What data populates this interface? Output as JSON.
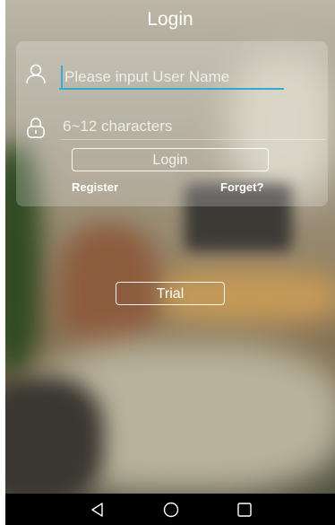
{
  "header": {
    "title": "Login"
  },
  "form": {
    "username_placeholder": "Please input User Name",
    "password_placeholder": "6~12 characters",
    "login_label": "Login",
    "register_label": "Register",
    "forget_label": "Forget?"
  },
  "trial": {
    "label": "Trial"
  },
  "icons": {
    "user": "user-icon",
    "lock": "lock-icon",
    "nav_back": "back-triangle-icon",
    "nav_home": "home-circle-icon",
    "nav_recent": "recent-square-icon"
  },
  "colors": {
    "accent": "#3aa7c9",
    "text": "#ffffff",
    "navbar": "#000000"
  }
}
